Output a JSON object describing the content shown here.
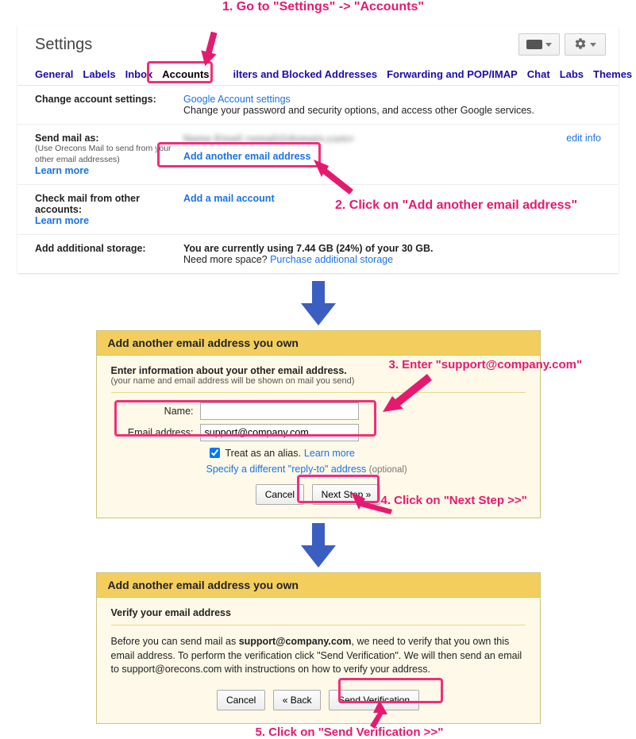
{
  "annotations": {
    "step1": "1. Go to \"Settings\" -> \"Accounts\"",
    "step2": "2. Click on \"Add another email address\"",
    "step3": "3. Enter \"support@company.com\"",
    "step4": "4. Click on \"Next Step >>\"",
    "step5": "5. Click on \"Send Verification >>\""
  },
  "settings": {
    "title": "Settings",
    "tabs": {
      "general": "General",
      "labels": "Labels",
      "inbox": "Inbox",
      "accounts": "Accounts",
      "filters": "ilters and Blocked Addresses",
      "forwarding": "Forwarding and POP/IMAP",
      "chat": "Chat",
      "labs": "Labs",
      "themes": "Themes"
    },
    "rows": {
      "change": {
        "label": "Change account settings:",
        "link": "Google Account settings",
        "desc": "Change your password and security options, and access other Google services."
      },
      "sendas": {
        "label": "Send mail as:",
        "sub": "(Use Orecons Mail to send from your other email addresses)",
        "learn": "Learn more",
        "addlink": "Add another email address",
        "editinfo": "edit info",
        "blurred": "Name Email <email@domain.com>"
      },
      "check": {
        "label": "Check mail from other accounts:",
        "learn": "Learn more",
        "link": "Add a mail account"
      },
      "storage": {
        "label": "Add additional storage:",
        "text_pre": "You are currently using ",
        "used": "7.44 GB (24%)",
        "text_mid": " of your ",
        "total": "30 GB",
        "need": "Need more space? ",
        "purchase": "Purchase additional storage"
      }
    }
  },
  "dialog1": {
    "title": "Add another email address you own",
    "intro_head": "Enter information about your other email address.",
    "intro_sub": "(your name and email address will be shown on mail you send)",
    "name_label": "Name:",
    "name_value": "",
    "email_label": "Email address:",
    "email_value": "support@company.com",
    "alias": "Treat as an alias.",
    "alias_learn": "Learn more",
    "replyto_link": "Specify a different \"reply-to\" address",
    "replyto_opt": "(optional)",
    "cancel": "Cancel",
    "next": "Next Step »"
  },
  "dialog2": {
    "title": "Add another email address you own",
    "subhead": "Verify your email address",
    "body_pre": "Before you can send mail as ",
    "body_email": "support@company.com",
    "body_post": ", we need to verify that you own this email address. To perform the verification click \"Send Verification\". We will then send an email to support@orecons.com with instructions on how to verify your address.",
    "cancel": "Cancel",
    "back": "« Back",
    "send": "Send Verification"
  }
}
